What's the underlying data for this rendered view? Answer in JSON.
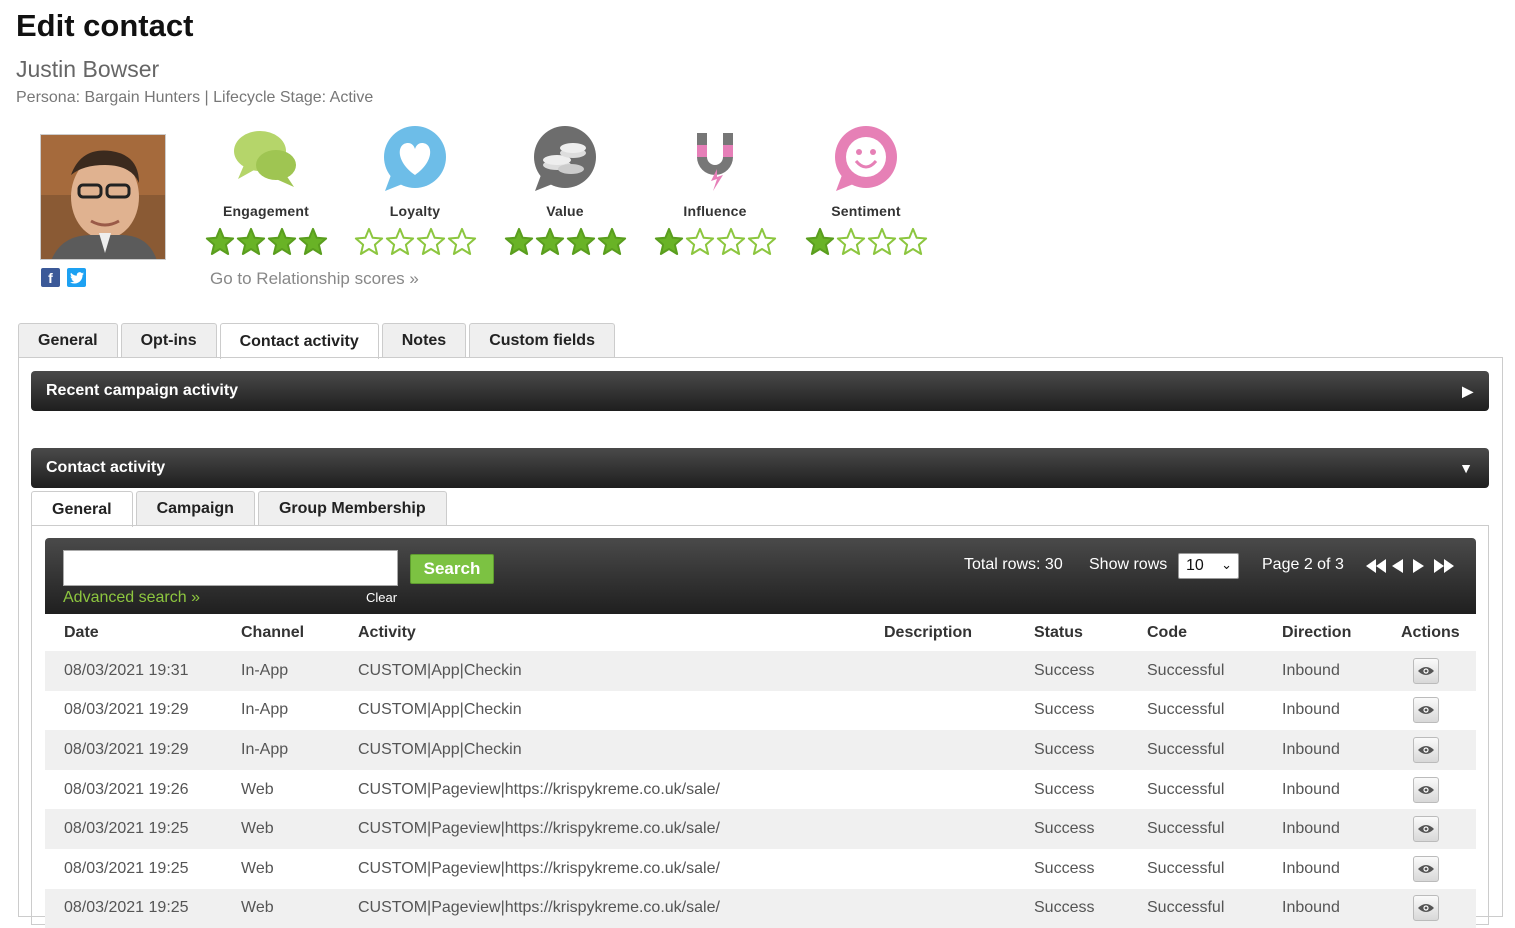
{
  "header": {
    "title": "Edit contact",
    "name": "Justin Bowser",
    "meta": "Persona: Bargain Hunters | Lifecycle Stage: Active"
  },
  "social": [
    "facebook-icon",
    "twitter-icon"
  ],
  "scores": [
    {
      "label": "Engagement",
      "stars": 4,
      "icon": "speech-bubbles-icon",
      "color": "#b5d56a"
    },
    {
      "label": "Loyalty",
      "stars": 0,
      "icon": "heart-icon",
      "color": "#6dbde8"
    },
    {
      "label": "Value",
      "stars": 4,
      "icon": "coins-icon",
      "color": "#6d6d6d"
    },
    {
      "label": "Influence",
      "stars": 1,
      "icon": "magnet-icon",
      "color": "#e67fb8"
    },
    {
      "label": "Sentiment",
      "stars": 1,
      "icon": "smiley-icon",
      "color": "#e680b6"
    }
  ],
  "relationship_link": "Go to Relationship scores »",
  "tabs": [
    "General",
    "Opt-ins",
    "Contact activity",
    "Notes",
    "Custom fields"
  ],
  "active_tab": "Contact activity",
  "sections": {
    "recent": "Recent campaign activity",
    "contact": "Contact activity"
  },
  "sub_tabs": [
    "General",
    "Campaign",
    "Group Membership"
  ],
  "grid": {
    "search_value": "",
    "search_button": "Search",
    "advanced_search": "Advanced search »",
    "clear": "Clear",
    "total_rows": "Total rows: 30",
    "show_rows_label": "Show rows",
    "rows_value": "10",
    "page_info": "Page 2 of 3"
  },
  "columns": [
    "Date",
    "Channel",
    "Activity",
    "Description",
    "Status",
    "Code",
    "Direction",
    "Actions"
  ],
  "rows": [
    {
      "date": "08/03/2021 19:31",
      "channel": "In-App",
      "activity": "CUSTOM|App|Checkin",
      "description": "",
      "status": "Success",
      "code": "Successful",
      "direction": "Inbound"
    },
    {
      "date": "08/03/2021 19:29",
      "channel": "In-App",
      "activity": "CUSTOM|App|Checkin",
      "description": "",
      "status": "Success",
      "code": "Successful",
      "direction": "Inbound"
    },
    {
      "date": "08/03/2021 19:29",
      "channel": "In-App",
      "activity": "CUSTOM|App|Checkin",
      "description": "",
      "status": "Success",
      "code": "Successful",
      "direction": "Inbound"
    },
    {
      "date": "08/03/2021 19:26",
      "channel": "Web",
      "activity": "CUSTOM|Pageview|https://krispykreme.co.uk/sale/",
      "description": "",
      "status": "Success",
      "code": "Successful",
      "direction": "Inbound"
    },
    {
      "date": "08/03/2021 19:25",
      "channel": "Web",
      "activity": "CUSTOM|Pageview|https://krispykreme.co.uk/sale/",
      "description": "",
      "status": "Success",
      "code": "Successful",
      "direction": "Inbound"
    },
    {
      "date": "08/03/2021 19:25",
      "channel": "Web",
      "activity": "CUSTOM|Pageview|https://krispykreme.co.uk/sale/",
      "description": "",
      "status": "Success",
      "code": "Successful",
      "direction": "Inbound"
    },
    {
      "date": "08/03/2021 19:25",
      "channel": "Web",
      "activity": "CUSTOM|Pageview|https://krispykreme.co.uk/sale/",
      "description": "",
      "status": "Success",
      "code": "Successful",
      "direction": "Inbound"
    }
  ]
}
